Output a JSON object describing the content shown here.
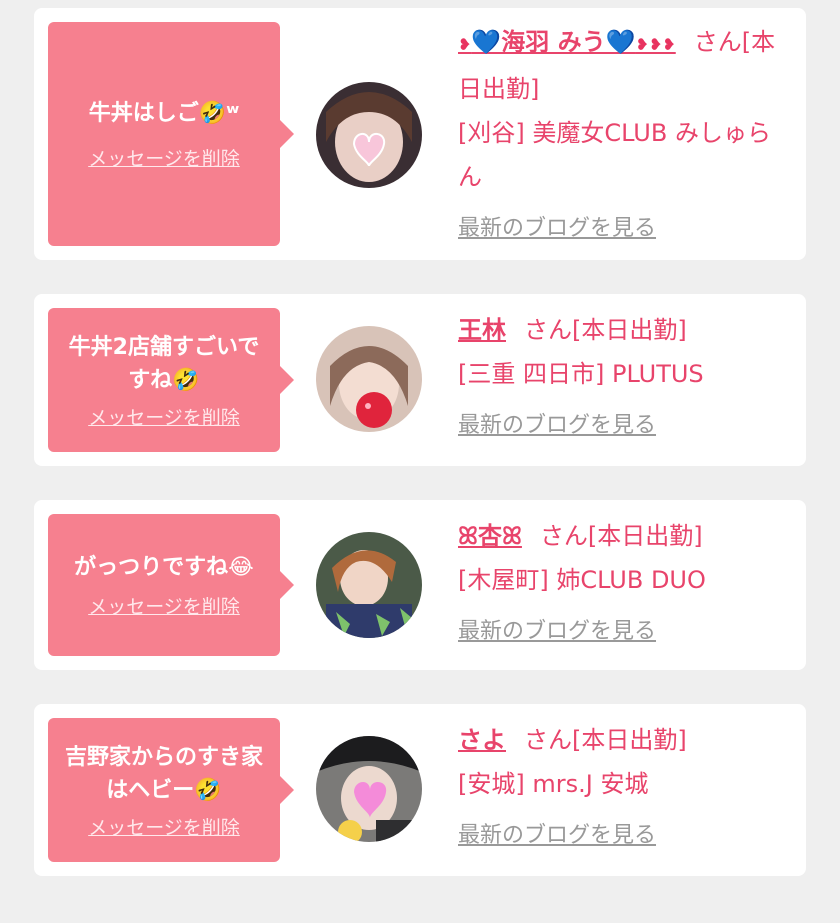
{
  "messages": [
    {
      "text": "牛丼はしご🤣ʷ",
      "delete_label": "メッセージを削除",
      "name_prefix": "❥",
      "name_core": "💙海羽 みう💙",
      "name_suffix": "❥❥❥",
      "san": "さん[本日出勤]",
      "shop": "[刈谷] 美魔女CLUB みしゅらん",
      "blog_label": "最新のブログを見る"
    },
    {
      "text": "牛丼2店舗すごいですね🤣",
      "delete_label": "メッセージを削除",
      "name_core": "王林",
      "san": "さん[本日出勤]",
      "shop": "[三重 四日市] PLUTUS",
      "blog_label": "最新のブログを見る"
    },
    {
      "text": "がっつりですね😂",
      "delete_label": "メッセージを削除",
      "name_core": "ꕤ杏ꕤ",
      "san": "さん[本日出勤]",
      "shop": "[木屋町] 姉CLUB DUO",
      "blog_label": "最新のブログを見る"
    },
    {
      "text": "吉野家からのすき家はヘビー🤣",
      "delete_label": "メッセージを削除",
      "name_core": "さよ",
      "san": "さん[本日出勤]",
      "shop": "[安城] mrs.J 安城",
      "blog_label": "最新のブログを見る"
    }
  ],
  "colors": {
    "bubble": "#f6808f",
    "name": "#e8446b",
    "blog_link": "#999999",
    "background": "#efefef"
  }
}
